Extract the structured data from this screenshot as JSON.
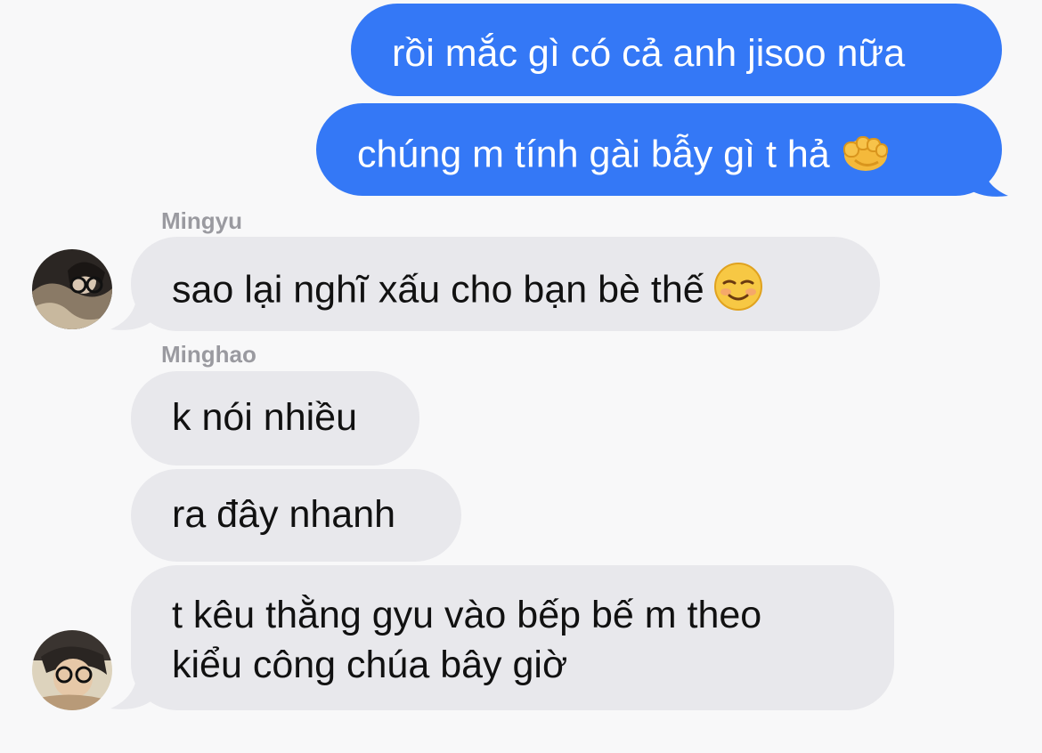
{
  "messages": {
    "m1": {
      "text": "rồi mắc gì có cả anh jisoo nữa"
    },
    "m2": {
      "text": "chúng m tính gài bẫy gì t hả",
      "emoji": "pointing-fist-emoji"
    },
    "m3": {
      "sender": "Mingyu",
      "text": "sao lại nghĩ xấu cho bạn bè thế",
      "emoji": "smiling-face-emoji"
    },
    "m4": {
      "sender": "Minghao",
      "text": "k nói nhiều"
    },
    "m5": {
      "text": "ra đây nhanh"
    },
    "m6": {
      "line1": "t kêu thằng gyu vào bếp bế m theo",
      "line2": "kiểu công chúa bây giờ"
    }
  },
  "colors": {
    "background": "#f8f8f9",
    "outgoing_bubble": "#3478f6",
    "incoming_bubble": "#e8e8ec",
    "sender_name": "#9a9aa0"
  }
}
